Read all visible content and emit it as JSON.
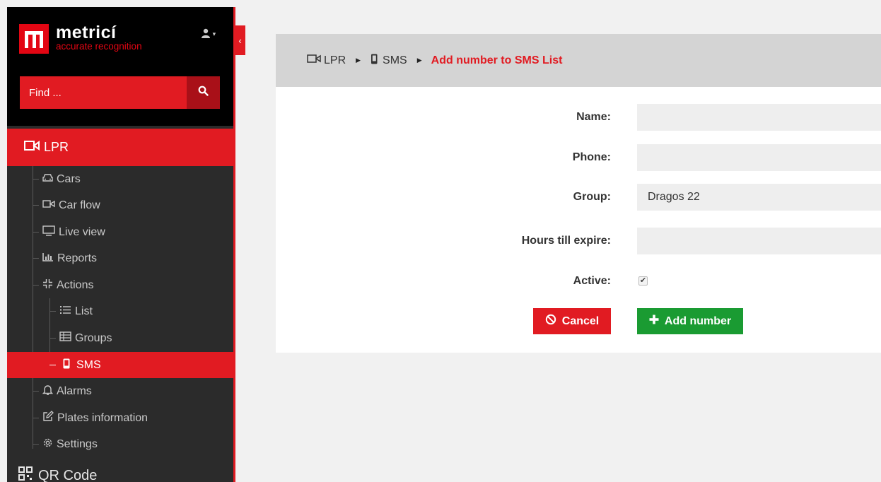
{
  "brand": {
    "name": "metricí",
    "tagline": "accurate recognition"
  },
  "search": {
    "placeholder": "Find ..."
  },
  "sidebar": {
    "section": "LPR",
    "items": [
      {
        "label": "Cars"
      },
      {
        "label": "Car flow"
      },
      {
        "label": "Live view"
      },
      {
        "label": "Reports"
      },
      {
        "label": "Actions"
      },
      {
        "label": "List"
      },
      {
        "label": "Groups"
      },
      {
        "label": "SMS"
      },
      {
        "label": "Alarms"
      },
      {
        "label": "Plates information"
      },
      {
        "label": "Settings"
      }
    ],
    "next_section": "QR Code"
  },
  "breadcrumb": {
    "items": [
      "LPR",
      "SMS"
    ],
    "current": "Add number to SMS List"
  },
  "form": {
    "name_label": "Name:",
    "phone_label": "Phone:",
    "group_label": "Group:",
    "group_value": "Dragos 22",
    "hours_label": "Hours till expire:",
    "active_label": "Active:",
    "active_checked": true,
    "cancel_label": "Cancel",
    "add_label": "Add number"
  },
  "colors": {
    "accent": "#e11b22",
    "success": "#1a9b32",
    "sidebar": "#2b2b2b"
  },
  "icons": [
    "camera-icon",
    "car-icon",
    "monitor-icon",
    "chart-icon",
    "actions-icon",
    "list-icon",
    "table-icon",
    "phone-icon",
    "bell-icon",
    "edit-icon",
    "gear-icon",
    "qrcode-icon",
    "search-icon",
    "user-icon",
    "chevron-left-icon",
    "ban-icon",
    "plus-icon"
  ]
}
